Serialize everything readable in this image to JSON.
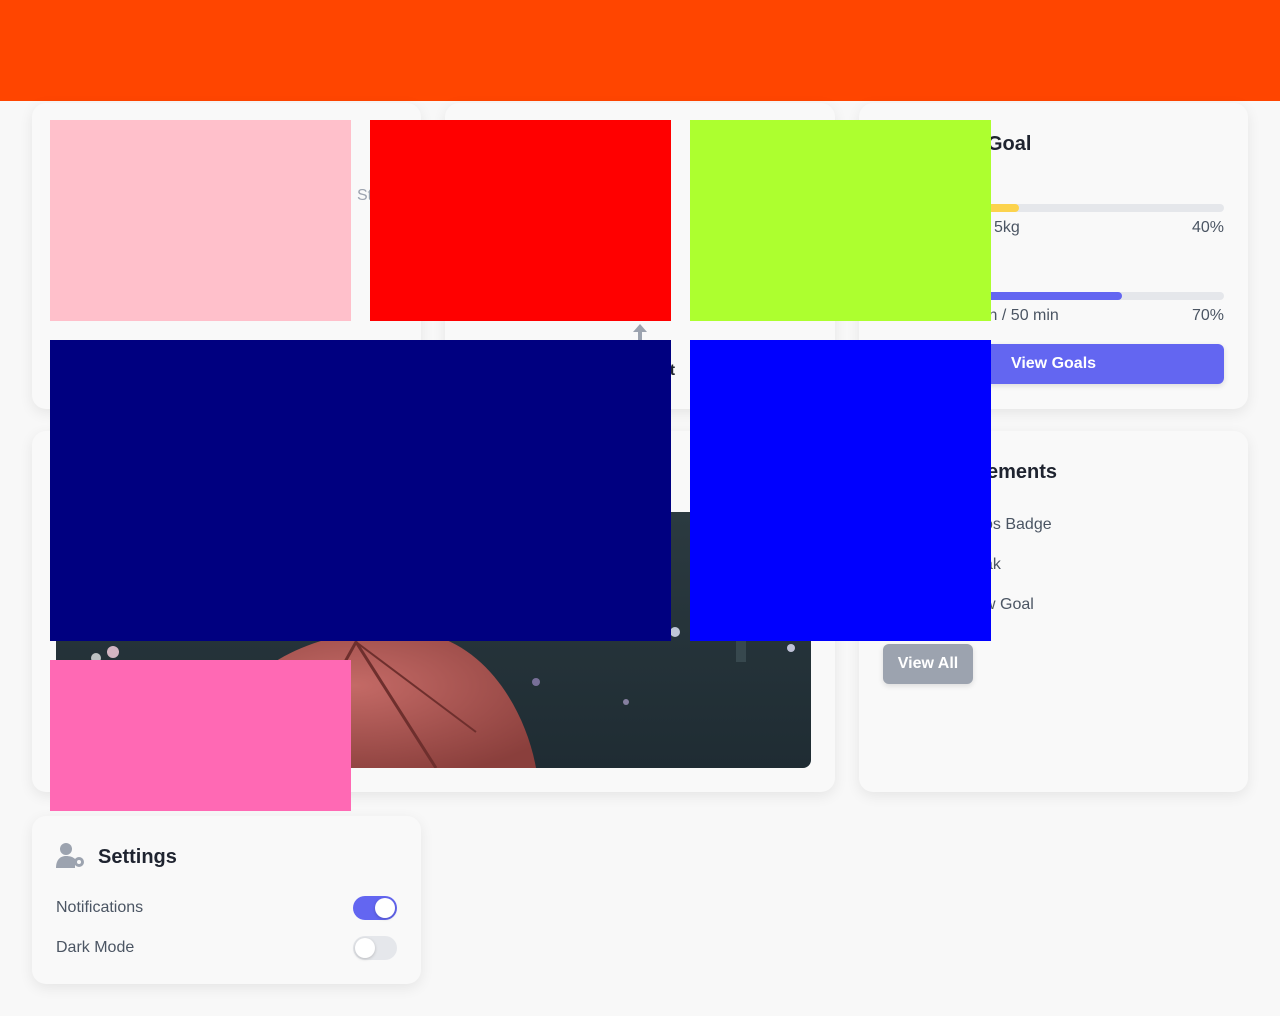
{
  "goal_card": {
    "title": "Goal",
    "goal1": {
      "value_text": "5kg",
      "percent_text": "40%",
      "progress": 0.4,
      "color": "#fcd34d"
    },
    "goal2": {
      "value_text": "in / 50 min",
      "percent_text": "70%",
      "progress": 0.7,
      "color": "#6366f1"
    },
    "button_label": "View Goals"
  },
  "middle_card": {
    "fragment_text": "nt"
  },
  "left_card": {
    "fragment_text": "St"
  },
  "achievements": {
    "title": "ements",
    "items": [
      "os Badge",
      "ak",
      "w Goal"
    ],
    "button_label": "View All"
  },
  "settings": {
    "title": "Settings",
    "icon": "user-gear-icon",
    "rows": [
      {
        "label": "Notifications",
        "on": true
      },
      {
        "label": "Dark Mode",
        "on": false
      }
    ]
  },
  "colors": {
    "header": "#ff4500",
    "accent": "#6366f1",
    "block_pink": "#ffc0cb",
    "block_red": "#ff0000",
    "block_lime": "#adff2f",
    "block_navy": "#000080",
    "block_blue": "#0000ff",
    "block_hotpink": "#ff69b4"
  }
}
